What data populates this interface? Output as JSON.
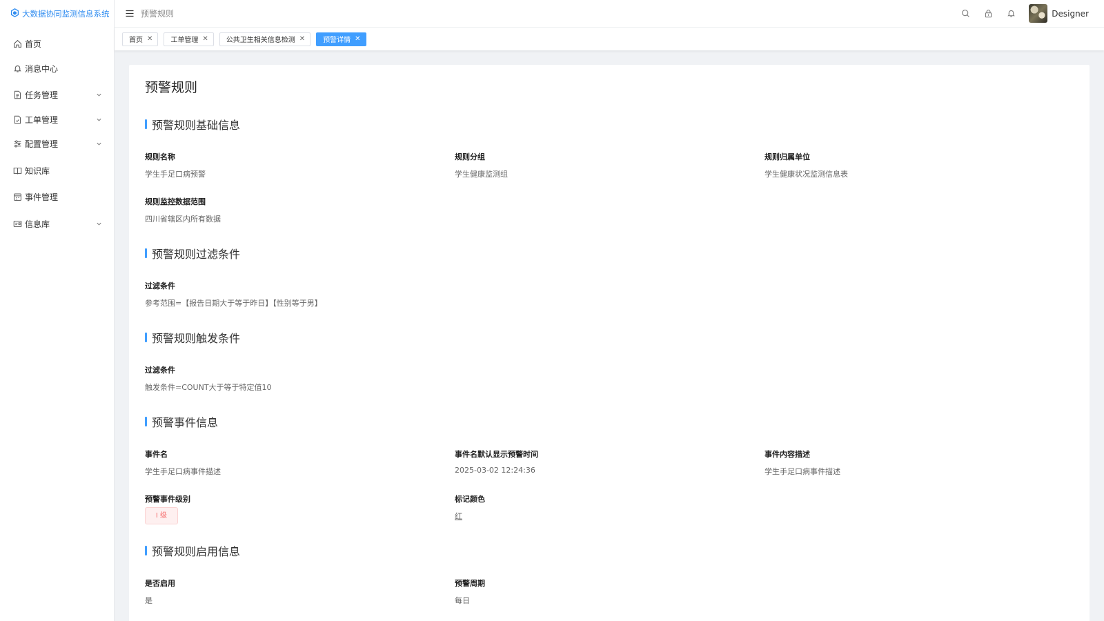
{
  "app": {
    "title": "大数据协同监测信息系统"
  },
  "sidebar": {
    "items": [
      {
        "label": "首页",
        "icon": "home-icon"
      },
      {
        "label": "消息中心",
        "icon": "bell-icon"
      },
      {
        "label": "任务管理",
        "icon": "document-icon",
        "expandable": true
      },
      {
        "label": "工单管理",
        "icon": "clipboard-check-icon",
        "expandable": true
      },
      {
        "label": "配置管理",
        "icon": "sliders-icon",
        "expandable": true
      },
      {
        "label": "知识库",
        "icon": "book-icon"
      },
      {
        "label": "事件管理",
        "icon": "calendar-icon"
      },
      {
        "label": "信息库",
        "icon": "id-card-icon",
        "expandable": true
      }
    ]
  },
  "header": {
    "breadcrumb": "预警规则",
    "username": "Designer",
    "icons": [
      "search-icon",
      "lock-icon",
      "bell-icon"
    ]
  },
  "tabs": [
    {
      "label": "首页",
      "active": false
    },
    {
      "label": "工单管理",
      "active": false
    },
    {
      "label": "公共卫生相关信息检测",
      "active": false
    },
    {
      "label": "预警详情",
      "active": true
    }
  ],
  "page": {
    "title": "预警规则",
    "sections": {
      "basic": {
        "title": "预警规则基础信息",
        "rule_name_label": "规则名称",
        "rule_name": "学生手足口病预警",
        "rule_group_label": "规则分组",
        "rule_group": "学生健康监测组",
        "rule_unit_label": "规则归属单位",
        "rule_unit": "学生健康状况监测信息表",
        "scope_label": "规则监控数据范围",
        "scope": "四川省辖区内所有数据"
      },
      "filter": {
        "title": "预警规则过滤条件",
        "label": "过滤条件",
        "value": "参考范围=【报告日期大于等于昨日】【性别等于男】"
      },
      "trigger": {
        "title": "预警规则触发条件",
        "label": "过滤条件",
        "value": "触发条件=COUNT大于等于特定值10"
      },
      "event": {
        "title": "预警事件信息",
        "name_label": "事件名",
        "name": "学生手足口病事件描述",
        "default_time_label": "事件名默认显示预警时间",
        "default_time": "2025-03-02 12:24:36",
        "desc_label": "事件内容描述",
        "desc": "学生手足口病事件描述",
        "level_label": "预警事件级别",
        "level": "I 级",
        "color_label": "标记颜色",
        "color": "红",
        "color_hex": "#f56c6c"
      },
      "enable": {
        "title": "预警规则启用信息",
        "enabled_label": "是否启用",
        "enabled": "是",
        "period_label": "预警周期",
        "period": "每日"
      }
    }
  },
  "colors": {
    "accent": "#409eff",
    "danger": "#f56c6c"
  }
}
